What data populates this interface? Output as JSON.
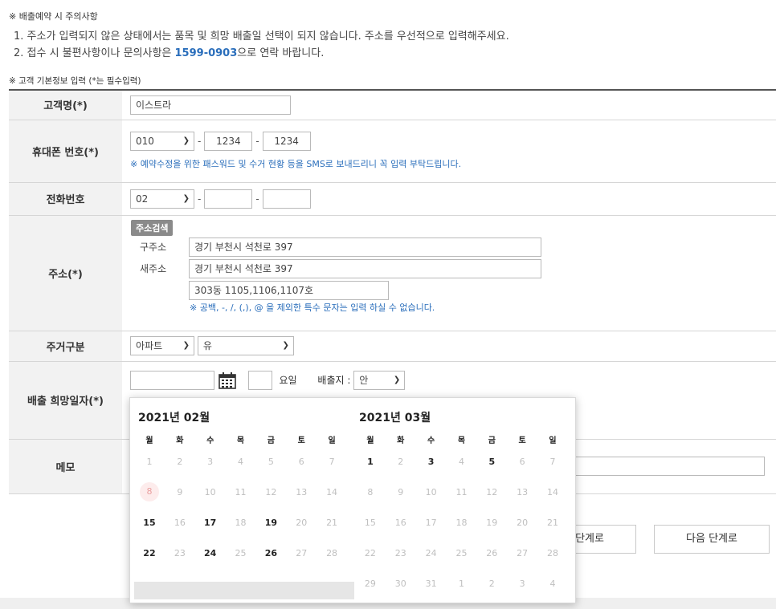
{
  "notice": {
    "title": "※ 배출예약 시 주의사항",
    "line1": "1. 주소가 입력되지 않은 상태에서는 품목 및 희망 배출일 선택이 되지 않습니다. 주소를 우선적으로 입력해주세요.",
    "line2_pre": "2. 접수 시 불편사항이나 문의사항은 ",
    "line2_phone": "1599-0903",
    "line2_post": "으로 연락 바랍니다."
  },
  "section_title": "※ 고객 기본정보 입력 (*는 필수입력)",
  "form": {
    "name": {
      "label": "고객명(*)",
      "value": "이스트라"
    },
    "mobile": {
      "label": "휴대폰 번호(*)",
      "prefix": "010",
      "mid": "1234",
      "last": "1234",
      "hint": "※ 예약수정을 위한 패스워드 및 수거 현황 등을 SMS로 보내드리니 꼭 입력 부탁드립니다."
    },
    "phone": {
      "label": "전화번호",
      "prefix": "02",
      "mid": "",
      "last": ""
    },
    "address": {
      "label": "주소(*)",
      "search_button": "주소검색",
      "old_label": "구주소",
      "old_value": "경기 부천시 석천로 397",
      "new_label": "새주소",
      "new_value": "경기 부천시 석천로 397",
      "detail_value": "303동 1105,1106,1107호",
      "hint": "※ 공백, -, /, (,), @ 을 제외한 특수 문자는 입력 하실 수 없습니다."
    },
    "housing": {
      "label": "주거구분",
      "type": "아파트",
      "elevator": "유"
    },
    "date": {
      "label": "배출 희망일자(*)",
      "value": "",
      "weekday_value": "",
      "weekday_label": "요일",
      "place_label": "배출지 :",
      "place_value": "안"
    },
    "memo": {
      "label": "메모",
      "value": ""
    }
  },
  "buttons": {
    "prev": "이전 단계로",
    "next": "다음 단계로"
  },
  "datepicker": {
    "weekdays": [
      "월",
      "화",
      "수",
      "목",
      "금",
      "토",
      "일"
    ],
    "months": [
      {
        "title": "2021년 02월",
        "weeks": [
          [
            "1",
            "2",
            "3",
            "4",
            "5",
            "6",
            "7"
          ],
          [
            "8",
            "9",
            "10",
            "11",
            "12",
            "13",
            "14"
          ],
          [
            "15",
            "16",
            "17",
            "18",
            "19",
            "20",
            "21"
          ],
          [
            "22",
            "23",
            "24",
            "25",
            "26",
            "27",
            "28"
          ]
        ],
        "available": [
          "15",
          "17",
          "19",
          "22",
          "24",
          "26"
        ],
        "today": "8"
      },
      {
        "title": "2021년 03월",
        "weeks": [
          [
            "1",
            "2",
            "3",
            "4",
            "5",
            "6",
            "7"
          ],
          [
            "8",
            "9",
            "10",
            "11",
            "12",
            "13",
            "14"
          ],
          [
            "15",
            "16",
            "17",
            "18",
            "19",
            "20",
            "21"
          ],
          [
            "22",
            "23",
            "24",
            "25",
            "26",
            "27",
            "28"
          ],
          [
            "29",
            "30",
            "31",
            "1",
            "2",
            "3",
            "4"
          ]
        ],
        "available": [
          "1",
          "3",
          "5"
        ],
        "today": ""
      }
    ]
  }
}
